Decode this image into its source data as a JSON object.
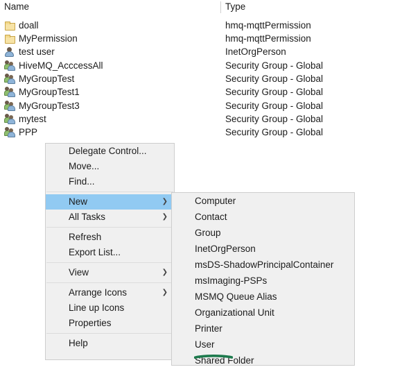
{
  "file_list": {
    "columns": [
      {
        "key": "name",
        "label": "Name"
      },
      {
        "key": "type",
        "label": "Type"
      }
    ],
    "rows": [
      {
        "name": "doall",
        "type": "hmq-mqttPermission",
        "icon": "folder-icon"
      },
      {
        "name": "MyPermission",
        "type": "hmq-mqttPermission",
        "icon": "folder-icon"
      },
      {
        "name": "test user",
        "type": "InetOrgPerson",
        "icon": "user-icon"
      },
      {
        "name": "HiveMQ_AcccessAll",
        "type": "Security Group - Global",
        "icon": "group-icon"
      },
      {
        "name": "MyGroupTest",
        "type": "Security Group - Global",
        "icon": "group-icon"
      },
      {
        "name": "MyGroupTest1",
        "type": "Security Group - Global",
        "icon": "group-icon"
      },
      {
        "name": "MyGroupTest3",
        "type": "Security Group - Global",
        "icon": "group-icon"
      },
      {
        "name": "mytest",
        "type": "Security Group - Global",
        "icon": "group-icon"
      },
      {
        "name": "PPP",
        "type": "Security Group - Global",
        "icon": "group-icon"
      }
    ]
  },
  "context_menu": {
    "items": [
      {
        "label": "Delegate Control...",
        "submenu": false,
        "highlighted": false
      },
      {
        "label": "Move...",
        "submenu": false,
        "highlighted": false
      },
      {
        "label": "Find...",
        "submenu": false,
        "highlighted": false
      },
      {
        "separator": true
      },
      {
        "label": "New",
        "submenu": true,
        "highlighted": true
      },
      {
        "label": "All Tasks",
        "submenu": true,
        "highlighted": false
      },
      {
        "separator": true
      },
      {
        "label": "Refresh",
        "submenu": false,
        "highlighted": false
      },
      {
        "label": "Export List...",
        "submenu": false,
        "highlighted": false
      },
      {
        "separator": true
      },
      {
        "label": "View",
        "submenu": true,
        "highlighted": false
      },
      {
        "separator": true
      },
      {
        "label": "Arrange Icons",
        "submenu": true,
        "highlighted": false
      },
      {
        "label": "Line up Icons",
        "submenu": false,
        "highlighted": false
      },
      {
        "label": "Properties",
        "submenu": false,
        "highlighted": false
      },
      {
        "separator": true
      },
      {
        "label": "Help",
        "submenu": false,
        "highlighted": false
      }
    ]
  },
  "submenu": {
    "parent": "New",
    "items": [
      {
        "label": "Computer",
        "annotated": false
      },
      {
        "label": "Contact",
        "annotated": false
      },
      {
        "label": "Group",
        "annotated": false
      },
      {
        "label": "InetOrgPerson",
        "annotated": false
      },
      {
        "label": "msDS-ShadowPrincipalContainer",
        "annotated": false
      },
      {
        "label": "msImaging-PSPs",
        "annotated": false
      },
      {
        "label": "MSMQ Queue Alias",
        "annotated": false
      },
      {
        "label": "Organizational Unit",
        "annotated": false
      },
      {
        "label": "Printer",
        "annotated": false
      },
      {
        "label": "User",
        "annotated": true
      },
      {
        "label": "Shared Folder",
        "annotated": false
      }
    ]
  },
  "annotation": {
    "target": "User",
    "shape": "underline-stroke",
    "color": "#1d7a4d"
  },
  "colors": {
    "menu_background": "#f0f0f0",
    "menu_border": "#cdcdcd",
    "highlight": "#91caf2",
    "text": "#1b1b1b",
    "annotation_green": "#1d7a4d",
    "page_background": "#ffffff"
  },
  "arrow_glyph": "❯"
}
